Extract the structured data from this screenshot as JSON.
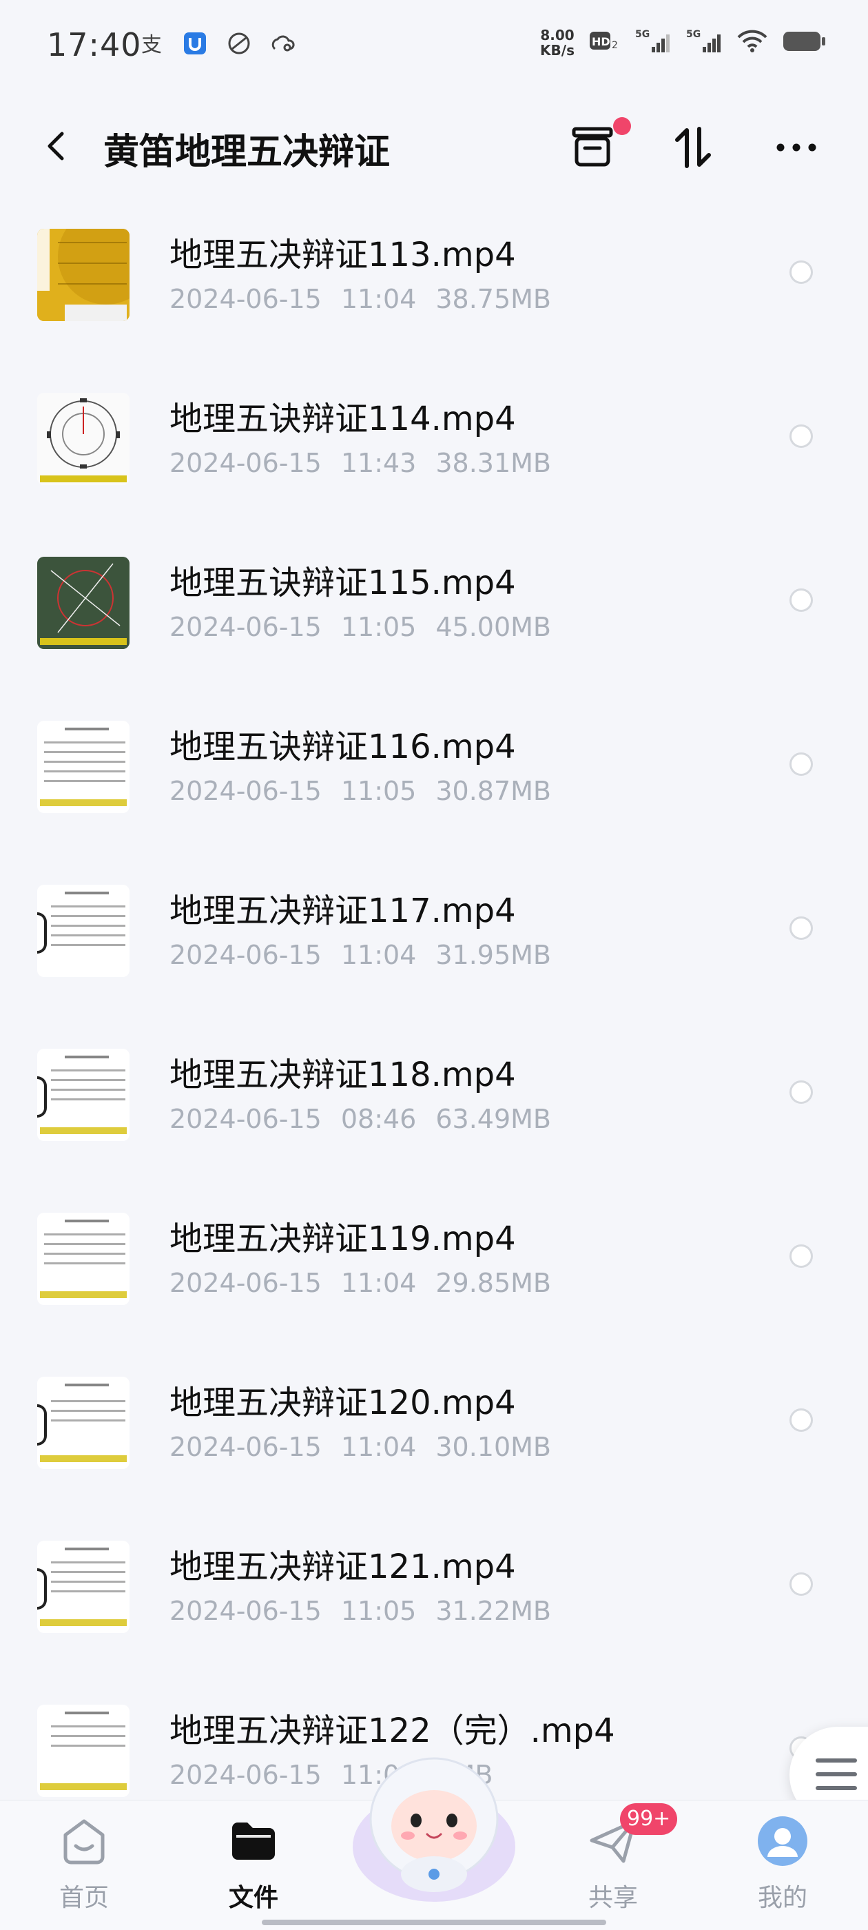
{
  "status_bar": {
    "time": "17:40",
    "speed_value": "8.00",
    "speed_unit": "KB/s",
    "network_1": "5G",
    "network_2": "5G",
    "hd_label": "HD"
  },
  "header": {
    "title": "黄笛地理五决辩证"
  },
  "files": [
    {
      "name": "地理五决辩证113.mp4",
      "date": "2024-06-15",
      "time": "11:04",
      "size": "38.75MB"
    },
    {
      "name": "地理五诀辩证114.mp4",
      "date": "2024-06-15",
      "time": "11:43",
      "size": "38.31MB"
    },
    {
      "name": "地理五诀辩证115.mp4",
      "date": "2024-06-15",
      "time": "11:05",
      "size": "45.00MB"
    },
    {
      "name": "地理五诀辩证116.mp4",
      "date": "2024-06-15",
      "time": "11:05",
      "size": "30.87MB"
    },
    {
      "name": "地理五决辩证117.mp4",
      "date": "2024-06-15",
      "time": "11:04",
      "size": "31.95MB"
    },
    {
      "name": "地理五决辩证118.mp4",
      "date": "2024-06-15",
      "time": "08:46",
      "size": "63.49MB"
    },
    {
      "name": "地理五决辩证119.mp4",
      "date": "2024-06-15",
      "time": "11:04",
      "size": "29.85MB"
    },
    {
      "name": "地理五决辩证120.mp4",
      "date": "2024-06-15",
      "time": "11:04",
      "size": "30.10MB"
    },
    {
      "name": "地理五决辩证121.mp4",
      "date": "2024-06-15",
      "time": "11:05",
      "size": "31.22MB"
    },
    {
      "name": "地理五决辩证122（完）.mp4",
      "date": "2024-06-15",
      "time": "11:0",
      "size": "00MB"
    }
  ],
  "nav": {
    "home": "首页",
    "files": "文件",
    "share": "共享",
    "mine": "我的",
    "share_badge": "99+"
  },
  "colors": {
    "accent_red": "#f0456a",
    "text_primary": "#111111",
    "text_secondary": "#aab0ba",
    "background": "#f5f6fa"
  }
}
